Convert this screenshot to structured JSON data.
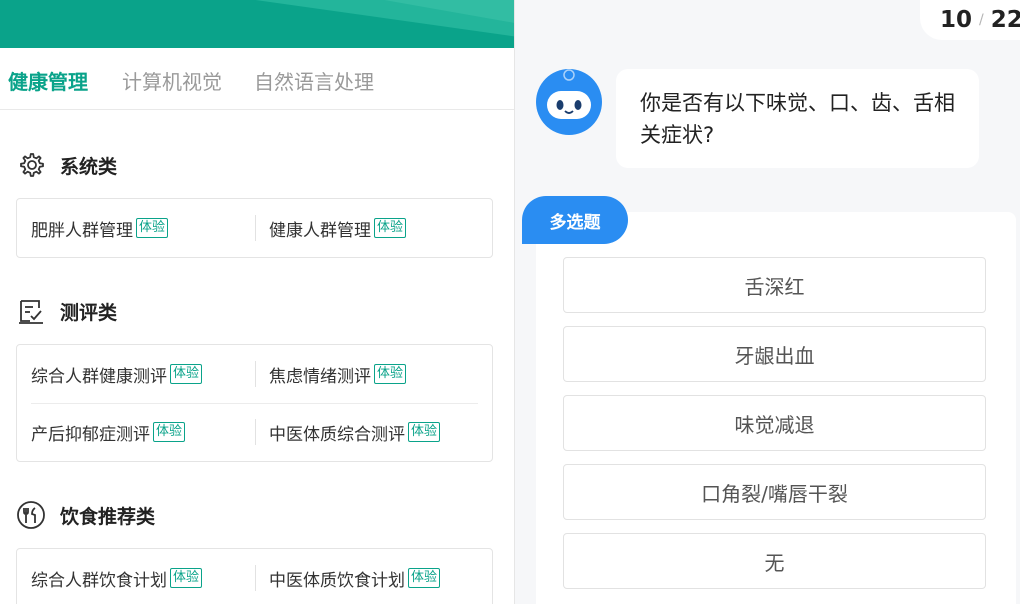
{
  "tabs": [
    {
      "label": "健康管理",
      "active": true
    },
    {
      "label": "计算机视觉",
      "active": false
    },
    {
      "label": "自然语言处理",
      "active": false
    }
  ],
  "sections": [
    {
      "title": "系统类",
      "icon": "gear-icon",
      "rows": [
        [
          {
            "label": "肥胖人群管理",
            "tag": "体验"
          },
          {
            "label": "健康人群管理",
            "tag": "体验"
          }
        ]
      ]
    },
    {
      "title": "测评类",
      "icon": "clipboard-check-icon",
      "rows": [
        [
          {
            "label": "综合人群健康测评",
            "tag": "体验"
          },
          {
            "label": "焦虑情绪测评",
            "tag": "体验"
          }
        ],
        [
          {
            "label": "产后抑郁症测评",
            "tag": "体验"
          },
          {
            "label": "中医体质综合测评",
            "tag": "体验"
          }
        ]
      ]
    },
    {
      "title": "饮食推荐类",
      "icon": "utensils-icon",
      "rows": [
        [
          {
            "label": "综合人群饮食计划",
            "tag": "体验"
          },
          {
            "label": "中医体质饮食计划",
            "tag": "体验"
          }
        ]
      ]
    }
  ],
  "progress": {
    "current": "10",
    "separator": "/",
    "total": "22"
  },
  "chat": {
    "question": "你是否有以下味觉、口、齿、舌相关症状?",
    "question_type": "多选题",
    "options": [
      "舌深红",
      "牙龈出血",
      "味觉减退",
      "口角裂/嘴唇干裂",
      "无"
    ]
  },
  "colors": {
    "accent": "#0aa38a",
    "blue": "#2a8df2"
  }
}
